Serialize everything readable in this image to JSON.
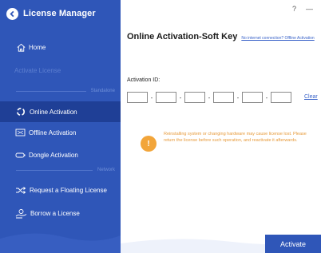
{
  "app": {
    "title": "License Manager"
  },
  "window_controls": {
    "help": "?",
    "minimize": "—"
  },
  "sidebar": {
    "home": "Home",
    "activate_license": "Activate License",
    "standalone_divider": "Standalone",
    "network_divider": "Network",
    "items": [
      {
        "label": "Online Activation",
        "icon": "cloud-icon",
        "active": true
      },
      {
        "label": "Offline Activation",
        "icon": "offline-icon",
        "active": false
      },
      {
        "label": "Dongle Activation",
        "icon": "dongle-icon",
        "active": false
      },
      {
        "label": "Request a Floating License",
        "icon": "shuffle-icon",
        "active": false
      },
      {
        "label": "Borrow a License",
        "icon": "borrow-icon",
        "active": false
      }
    ]
  },
  "main": {
    "heading": "Online Activation-Soft Key",
    "no_internet_link": "No internet connection? Offline Activation",
    "activation_id_label": "Activation ID:",
    "key_fields": [
      "",
      "",
      "",
      "",
      "",
      ""
    ],
    "clear_label": "Clear",
    "warning_text": "Reinstalling system or changing hardware may cause license lost. Please return the license before such operation, and reactivate it afterwards.",
    "activate_label": "Activate"
  },
  "colors": {
    "sidebar": "#2f56b8",
    "active_item": "#1f3f96",
    "warning": "#f2a53a",
    "link": "#3a63c9"
  }
}
